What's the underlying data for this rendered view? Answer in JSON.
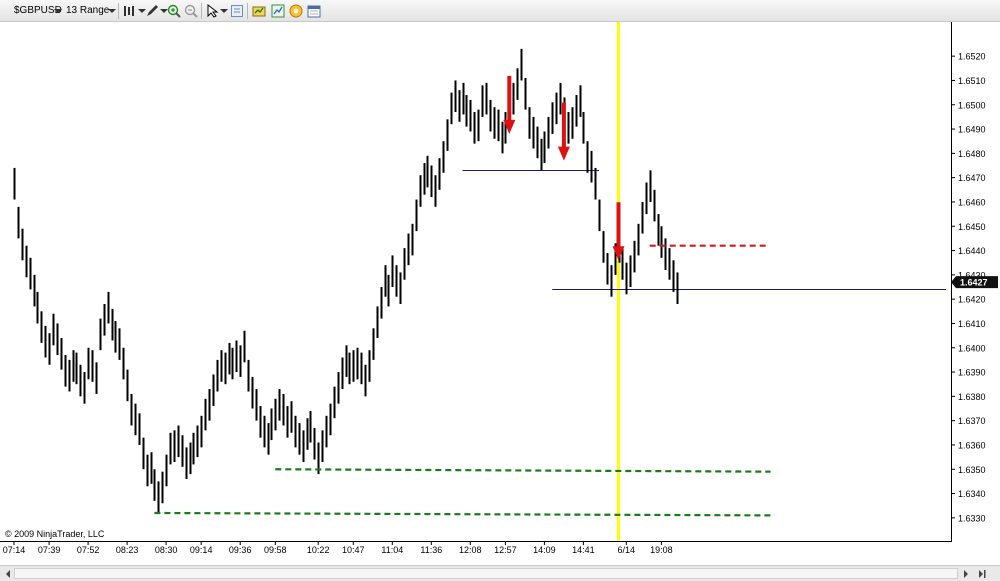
{
  "toolbar": {
    "instrument": "$GBPUSD",
    "bar_type": "13 Range",
    "icons": [
      "dropdown-arrow-icon",
      "bar-style-icon",
      "draw-pen-icon",
      "zoom-in-icon",
      "zoom-out-icon",
      "pointer-icon",
      "properties-icon",
      "data-box-icon",
      "chart-trader-icon",
      "strategy-icon",
      "calendar-icon"
    ]
  },
  "copyright": "© 2009 NinjaTrader, LLC",
  "colors": {
    "bars": "#000000",
    "arrow": "#dd1111",
    "vline": "#ffff00",
    "support_green": "#1b7a1b",
    "resistance_red": "#d41a1a",
    "hline": "#1a1a66",
    "price_tag_bg": "#111111"
  },
  "chart_data": {
    "type": "ohlc",
    "instrument": "$GBPUSD",
    "bar_type": "13 Range",
    "ylim": [
      1.6325,
      1.6525
    ],
    "y_ticks": [
      "1.6520",
      "1.6510",
      "1.6500",
      "1.6490",
      "1.6480",
      "1.6470",
      "1.6460",
      "1.6450",
      "1.6440",
      "1.6430",
      "1.6420",
      "1.6410",
      "1.6400",
      "1.6390",
      "1.6380",
      "1.6370",
      "1.6360",
      "1.6350",
      "1.6340",
      "1.6330"
    ],
    "y_tick_values": [
      1.652,
      1.651,
      1.65,
      1.649,
      1.648,
      1.647,
      1.646,
      1.645,
      1.644,
      1.643,
      1.642,
      1.641,
      1.64,
      1.639,
      1.638,
      1.637,
      1.636,
      1.635,
      1.634,
      1.633
    ],
    "x_ticks": [
      {
        "label": "07:14",
        "bar": 0
      },
      {
        "label": "07:39",
        "bar": 9
      },
      {
        "label": "07:52",
        "bar": 19
      },
      {
        "label": "08:23",
        "bar": 29
      },
      {
        "label": "08:30",
        "bar": 39
      },
      {
        "label": "09:14",
        "bar": 48
      },
      {
        "label": "09:36",
        "bar": 58
      },
      {
        "label": "09:58",
        "bar": 67
      },
      {
        "label": "10:22",
        "bar": 78
      },
      {
        "label": "10:47",
        "bar": 87
      },
      {
        "label": "11:04",
        "bar": 97
      },
      {
        "label": "11:36",
        "bar": 107
      },
      {
        "label": "12:08",
        "bar": 117
      },
      {
        "label": "12:57",
        "bar": 126
      },
      {
        "label": "14:09",
        "bar": 136
      },
      {
        "label": "14:41",
        "bar": 146
      },
      {
        "label": "6/14",
        "bar": 157
      },
      {
        "label": "19:08",
        "bar": 166
      }
    ],
    "last_price": "1.6427",
    "bars": [
      [
        1.6474,
        1.6461
      ],
      [
        1.6458,
        1.6445
      ],
      [
        1.6449,
        1.6436
      ],
      [
        1.6442,
        1.6429
      ],
      [
        1.6437,
        1.6424
      ],
      [
        1.643,
        1.6417
      ],
      [
        1.6423,
        1.641
      ],
      [
        1.6415,
        1.6402
      ],
      [
        1.6409,
        1.6396
      ],
      [
        1.6406,
        1.6393
      ],
      [
        1.6414,
        1.6401
      ],
      [
        1.641,
        1.6397
      ],
      [
        1.6404,
        1.6391
      ],
      [
        1.6397,
        1.6384
      ],
      [
        1.6395,
        1.6382
      ],
      [
        1.6399,
        1.6386
      ],
      [
        1.6398,
        1.6385
      ],
      [
        1.6393,
        1.638
      ],
      [
        1.639,
        1.6377
      ],
      [
        1.64,
        1.6387
      ],
      [
        1.6399,
        1.6386
      ],
      [
        1.6394,
        1.6381
      ],
      [
        1.6412,
        1.6399
      ],
      [
        1.6418,
        1.6405
      ],
      [
        1.6423,
        1.641
      ],
      [
        1.6416,
        1.6403
      ],
      [
        1.6411,
        1.6398
      ],
      [
        1.6408,
        1.6395
      ],
      [
        1.64,
        1.6387
      ],
      [
        1.6391,
        1.6378
      ],
      [
        1.6381,
        1.6368
      ],
      [
        1.6377,
        1.6364
      ],
      [
        1.6373,
        1.636
      ],
      [
        1.6363,
        1.635
      ],
      [
        1.6356,
        1.6343
      ],
      [
        1.6357,
        1.6344
      ],
      [
        1.635,
        1.6337
      ],
      [
        1.6345,
        1.6332
      ],
      [
        1.6349,
        1.6336
      ],
      [
        1.6356,
        1.6343
      ],
      [
        1.6365,
        1.6352
      ],
      [
        1.6366,
        1.6353
      ],
      [
        1.6368,
        1.6355
      ],
      [
        1.6364,
        1.6351
      ],
      [
        1.6359,
        1.6346
      ],
      [
        1.6361,
        1.6348
      ],
      [
        1.6365,
        1.6352
      ],
      [
        1.6368,
        1.6355
      ],
      [
        1.6372,
        1.6359
      ],
      [
        1.6379,
        1.6366
      ],
      [
        1.6383,
        1.637
      ],
      [
        1.6389,
        1.6376
      ],
      [
        1.6395,
        1.6382
      ],
      [
        1.6399,
        1.6386
      ],
      [
        1.6398,
        1.6385
      ],
      [
        1.6402,
        1.6389
      ],
      [
        1.64,
        1.6387
      ],
      [
        1.6403,
        1.639
      ],
      [
        1.6401,
        1.6388
      ],
      [
        1.6407,
        1.6394
      ],
      [
        1.6395,
        1.6382
      ],
      [
        1.6388,
        1.6375
      ],
      [
        1.6383,
        1.637
      ],
      [
        1.6376,
        1.6363
      ],
      [
        1.6372,
        1.6359
      ],
      [
        1.6369,
        1.6356
      ],
      [
        1.6375,
        1.6362
      ],
      [
        1.6379,
        1.6366
      ],
      [
        1.6383,
        1.637
      ],
      [
        1.6381,
        1.6368
      ],
      [
        1.6376,
        1.6363
      ],
      [
        1.6378,
        1.6365
      ],
      [
        1.6372,
        1.6359
      ],
      [
        1.6369,
        1.6356
      ],
      [
        1.6366,
        1.6353
      ],
      [
        1.6371,
        1.6358
      ],
      [
        1.6374,
        1.6361
      ],
      [
        1.6367,
        1.6354
      ],
      [
        1.6361,
        1.6348
      ],
      [
        1.6366,
        1.6353
      ],
      [
        1.6372,
        1.6359
      ],
      [
        1.6377,
        1.6364
      ],
      [
        1.6384,
        1.6371
      ],
      [
        1.639,
        1.6377
      ],
      [
        1.6396,
        1.6383
      ],
      [
        1.6401,
        1.6388
      ],
      [
        1.6398,
        1.6385
      ],
      [
        1.6399,
        1.6386
      ],
      [
        1.64,
        1.6387
      ],
      [
        1.6398,
        1.6385
      ],
      [
        1.6393,
        1.638
      ],
      [
        1.6399,
        1.6386
      ],
      [
        1.6408,
        1.6395
      ],
      [
        1.6417,
        1.6404
      ],
      [
        1.6425,
        1.6412
      ],
      [
        1.6434,
        1.6421
      ],
      [
        1.643,
        1.6417
      ],
      [
        1.6438,
        1.6425
      ],
      [
        1.6434,
        1.6421
      ],
      [
        1.6431,
        1.6418
      ],
      [
        1.6441,
        1.6428
      ],
      [
        1.6447,
        1.6434
      ],
      [
        1.6451,
        1.6438
      ],
      [
        1.6461,
        1.6448
      ],
      [
        1.6471,
        1.6458
      ],
      [
        1.6476,
        1.6463
      ],
      [
        1.6479,
        1.6466
      ],
      [
        1.6475,
        1.6462
      ],
      [
        1.6471,
        1.6458
      ],
      [
        1.6478,
        1.6465
      ],
      [
        1.6485,
        1.6472
      ],
      [
        1.6494,
        1.6481
      ],
      [
        1.6505,
        1.6492
      ],
      [
        1.651,
        1.6497
      ],
      [
        1.6506,
        1.6493
      ],
      [
        1.6509,
        1.6496
      ],
      [
        1.6504,
        1.6491
      ],
      [
        1.6502,
        1.6489
      ],
      [
        1.6497,
        1.6484
      ],
      [
        1.6498,
        1.6485
      ],
      [
        1.6508,
        1.6495
      ],
      [
        1.6509,
        1.6496
      ],
      [
        1.6502,
        1.6489
      ],
      [
        1.6499,
        1.6486
      ],
      [
        1.6498,
        1.6485
      ],
      [
        1.6493,
        1.648
      ],
      [
        1.6497,
        1.6484
      ],
      [
        1.6504,
        1.6491
      ],
      [
        1.6509,
        1.6496
      ],
      [
        1.6515,
        1.6502
      ],
      [
        1.6523,
        1.651
      ],
      [
        1.6511,
        1.6498
      ],
      [
        1.6499,
        1.6486
      ],
      [
        1.6495,
        1.6482
      ],
      [
        1.6491,
        1.6478
      ],
      [
        1.6486,
        1.6473
      ],
      [
        1.6489,
        1.6476
      ],
      [
        1.6495,
        1.6482
      ],
      [
        1.6501,
        1.6488
      ],
      [
        1.6505,
        1.6492
      ],
      [
        1.6509,
        1.6496
      ],
      [
        1.6503,
        1.649
      ],
      [
        1.6497,
        1.6484
      ],
      [
        1.6499,
        1.6486
      ],
      [
        1.6504,
        1.6491
      ],
      [
        1.6508,
        1.6495
      ],
      [
        1.6497,
        1.6484
      ],
      [
        1.6485,
        1.6472
      ],
      [
        1.6481,
        1.6468
      ],
      [
        1.6474,
        1.6461
      ],
      [
        1.6461,
        1.6448
      ],
      [
        1.6448,
        1.6435
      ],
      [
        1.6439,
        1.6426
      ],
      [
        1.6434,
        1.6421
      ],
      [
        1.6443,
        1.643
      ],
      [
        1.6448,
        1.6435
      ],
      [
        1.6441,
        1.6428
      ],
      [
        1.6435,
        1.6422
      ],
      [
        1.6438,
        1.6425
      ],
      [
        1.6444,
        1.6431
      ],
      [
        1.6451,
        1.6438
      ],
      [
        1.646,
        1.6447
      ],
      [
        1.6468,
        1.6455
      ],
      [
        1.6473,
        1.646
      ],
      [
        1.6465,
        1.6452
      ],
      [
        1.6455,
        1.6442
      ],
      [
        1.645,
        1.6437
      ],
      [
        1.6445,
        1.6432
      ],
      [
        1.6441,
        1.6428
      ],
      [
        1.6436,
        1.6423
      ],
      [
        1.6431,
        1.6418
      ]
    ],
    "annotations": {
      "vline_bar": 155,
      "arrows_down": [
        {
          "bar": 127,
          "tip_price": 1.6488
        },
        {
          "bar": 141,
          "tip_price": 1.6477
        },
        {
          "bar": 155,
          "tip_price": 1.6436
        }
      ],
      "hlines": [
        {
          "price": 1.6473,
          "from_bar": 115,
          "to_bar": 150,
          "color": "hline"
        },
        {
          "price": 1.6424,
          "from_bar": 138,
          "to_bar": 999,
          "color": "hline"
        }
      ],
      "dashed_lines": [
        {
          "price": 1.6442,
          "from_bar": 163,
          "to_bar": 193,
          "color": "resistance_red"
        },
        {
          "price": 1.635,
          "from_bar": 67,
          "to_bar": 194,
          "end_price": 1.6349,
          "color": "support_green"
        },
        {
          "price": 1.6332,
          "from_bar": 36,
          "to_bar": 195,
          "end_price": 1.6331,
          "color": "support_green"
        }
      ]
    }
  }
}
